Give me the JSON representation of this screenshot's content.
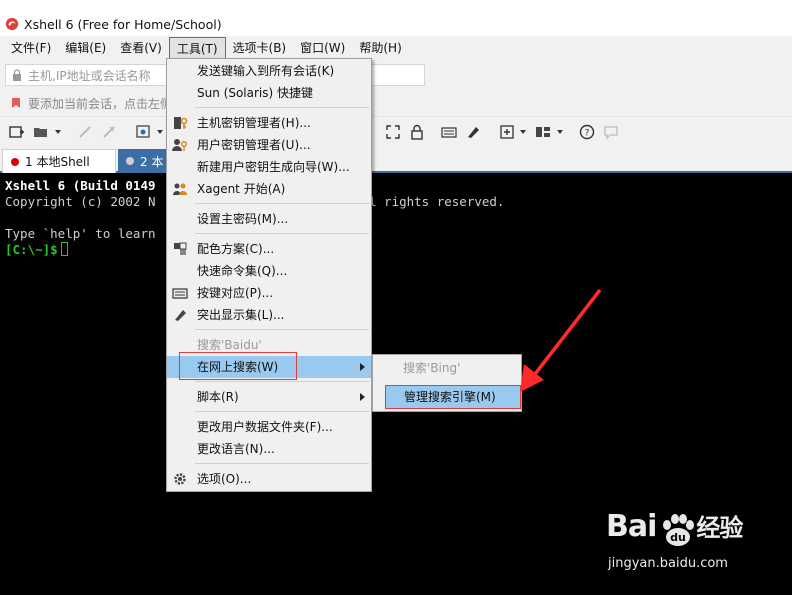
{
  "window": {
    "title": "Xshell 6 (Free for Home/School)"
  },
  "menubar": {
    "items": [
      {
        "label": "文件(F)"
      },
      {
        "label": "编辑(E)"
      },
      {
        "label": "查看(V)"
      },
      {
        "label": "工具(T)"
      },
      {
        "label": "选项卡(B)"
      },
      {
        "label": "窗口(W)"
      },
      {
        "label": "帮助(H)"
      }
    ]
  },
  "address": {
    "placeholder": "主机,IP地址或会话名称"
  },
  "infobar": {
    "text": "要添加当前会话，点击左侧"
  },
  "tabs": [
    {
      "label": "1 本地Shell",
      "dot_color": "#e00000"
    },
    {
      "label": "2 本",
      "dot_color": "#d0d0d0"
    }
  ],
  "terminal": {
    "line1": "Xshell 6 (Build 0149",
    "line1_tail": "l rights reserved.",
    "line2": "Copyright (c) 2002 N",
    "line3": "Type `help' to learn",
    "prompt": "[C:\\~]$"
  },
  "tools_menu": {
    "items": {
      "send_keys": "发送键输入到所有会话(K)",
      "sun_keys": "Sun (Solaris) 快捷键",
      "host_key_mgr": "主机密钥管理者(H)...",
      "user_key_mgr": "用户密钥管理者(U)...",
      "new_key_wizard": "新建用户密钥生成向导(W)...",
      "xagent": "Xagent 开始(A)",
      "master_pw": "设置主密码(M)...",
      "color_scheme": "配色方案(C)...",
      "quick_cmd": "快速命令集(Q)...",
      "key_map": "按键对应(P)...",
      "highlight": "突出显示集(L)...",
      "search_baidu": "搜索'Baidu'",
      "search_web": "在网上搜索(W)",
      "script": "脚本(R)",
      "change_data_folder": "更改用户数据文件夹(F)...",
      "change_lang": "更改语言(N)...",
      "options": "选项(O)..."
    }
  },
  "sub_menu": {
    "search_bing": "搜索'Bing'",
    "manage_engines": "管理搜索引擎(M)"
  },
  "colors": {
    "accent_blue": "#3b6ea5",
    "highlight_blue": "#99c9ef",
    "annotation_red": "#e23b3b",
    "terminal_green": "#26c926"
  },
  "watermark": {
    "logo_text_a": "Bai",
    "logo_text_b": "经验",
    "url": "jingyan.baidu.com"
  }
}
